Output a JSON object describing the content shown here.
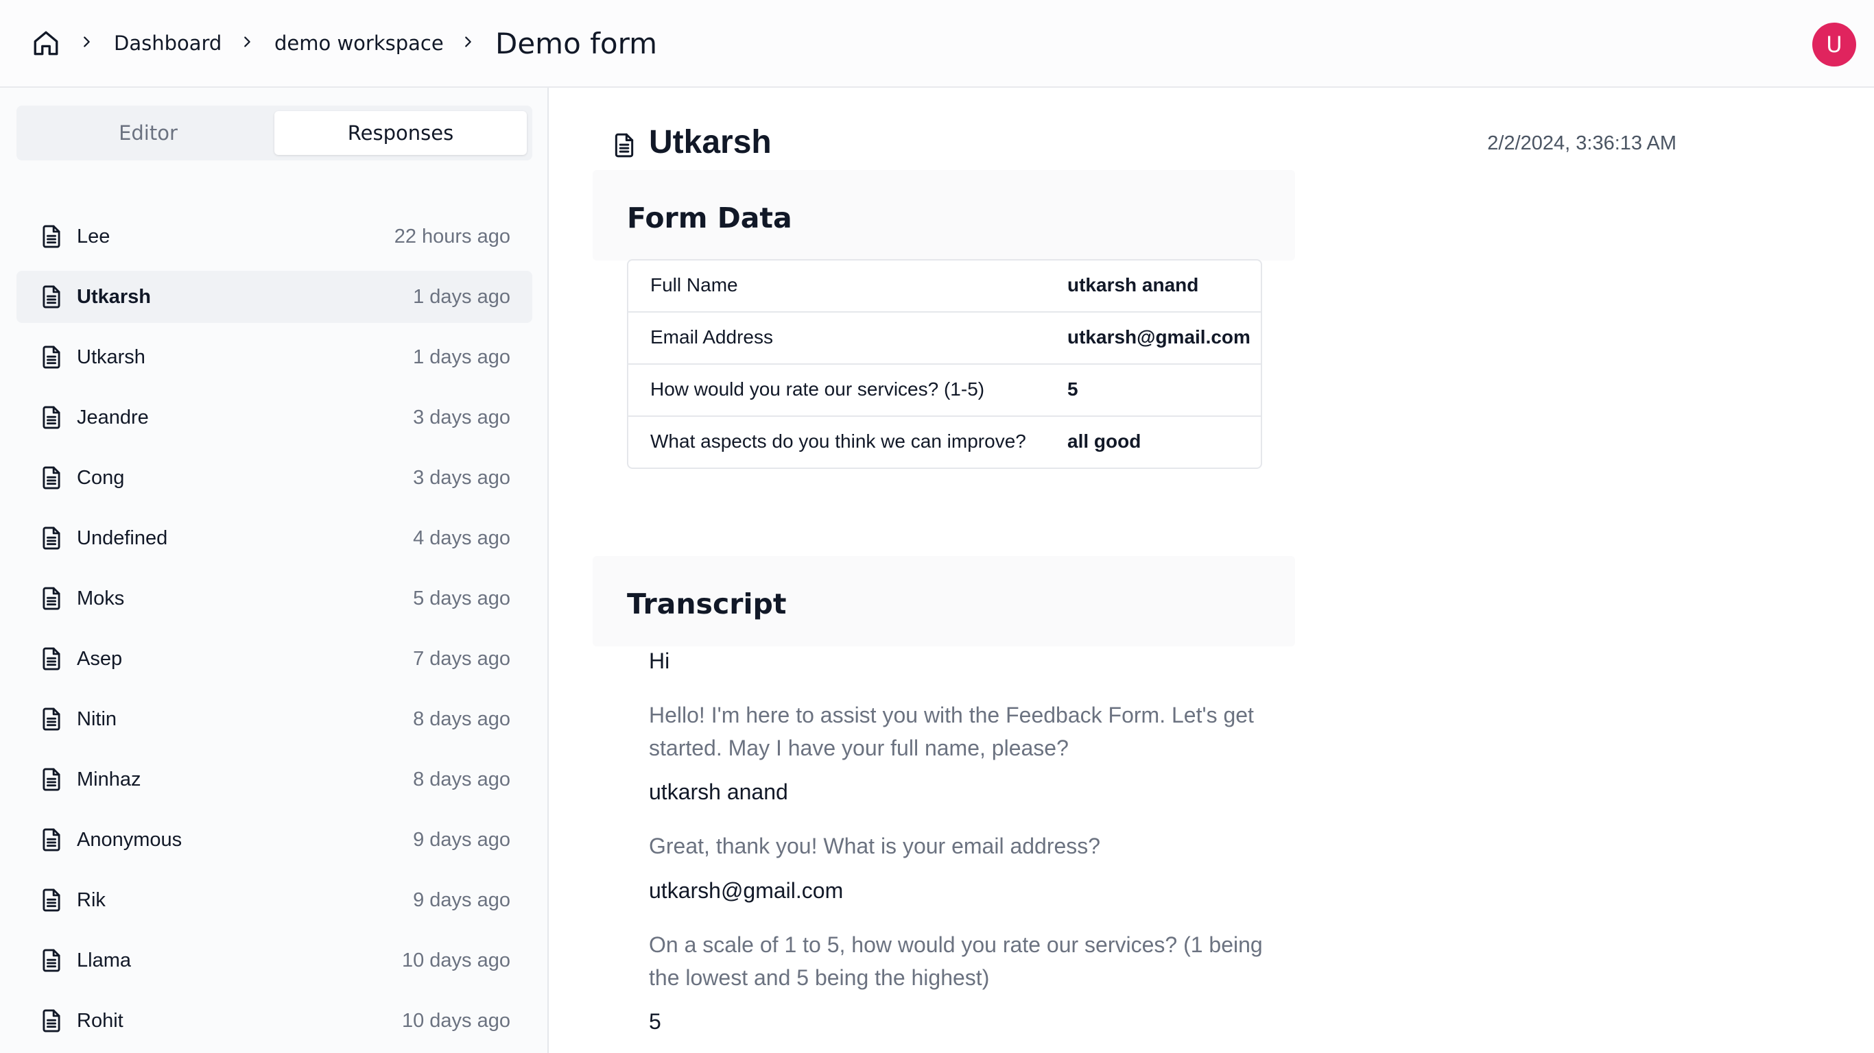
{
  "breadcrumb": {
    "home_icon": "home-icon",
    "items": [
      "Dashboard",
      "demo workspace"
    ],
    "current": "Demo form"
  },
  "user": {
    "avatar_initial": "U",
    "avatar_color": "#e0245e"
  },
  "sidebar": {
    "tabs": [
      "Editor",
      "Responses"
    ],
    "active_tab": "Responses",
    "responses": [
      {
        "name": "Lee",
        "time": "22 hours ago"
      },
      {
        "name": "Utkarsh",
        "time": "1 days ago",
        "active": true
      },
      {
        "name": "Utkarsh",
        "time": "1 days ago"
      },
      {
        "name": "Jeandre",
        "time": "3 days ago"
      },
      {
        "name": "Cong",
        "time": "3 days ago"
      },
      {
        "name": "Undefined",
        "time": "4 days ago"
      },
      {
        "name": "Moks",
        "time": "5 days ago"
      },
      {
        "name": "Asep",
        "time": "7 days ago"
      },
      {
        "name": "Nitin",
        "time": "8 days ago"
      },
      {
        "name": "Minhaz",
        "time": "8 days ago"
      },
      {
        "name": "Anonymous",
        "time": "9 days ago"
      },
      {
        "name": "Rik",
        "time": "9 days ago"
      },
      {
        "name": "Llama",
        "time": "10 days ago"
      },
      {
        "name": "Rohit",
        "time": "10 days ago"
      }
    ]
  },
  "detail": {
    "title": "Utkarsh",
    "timestamp": "2/2/2024, 3:36:13 AM",
    "form_data_title": "Form Data",
    "form_data": [
      {
        "label": "Full Name",
        "value": "utkarsh anand"
      },
      {
        "label": "Email Address",
        "value": "utkarsh@gmail.com"
      },
      {
        "label": "How would you rate our services? (1-5)",
        "value": "5"
      },
      {
        "label": "What aspects do you think we can improve?",
        "value": "all good"
      }
    ],
    "transcript_title": "Transcript",
    "transcript": [
      {
        "role": "user",
        "text": "Hi"
      },
      {
        "role": "bot",
        "text": "Hello! I'm here to assist you with the Feedback Form. Let's get started. May I have your full name, please?"
      },
      {
        "role": "user",
        "text": "utkarsh anand"
      },
      {
        "role": "bot",
        "text": "Great, thank you! What is your email address?"
      },
      {
        "role": "user",
        "text": "utkarsh@gmail.com"
      },
      {
        "role": "bot",
        "text": "On a scale of 1 to 5, how would you rate our services? (1 being the lowest and 5 being the highest)"
      },
      {
        "role": "user",
        "text": "5"
      }
    ]
  }
}
